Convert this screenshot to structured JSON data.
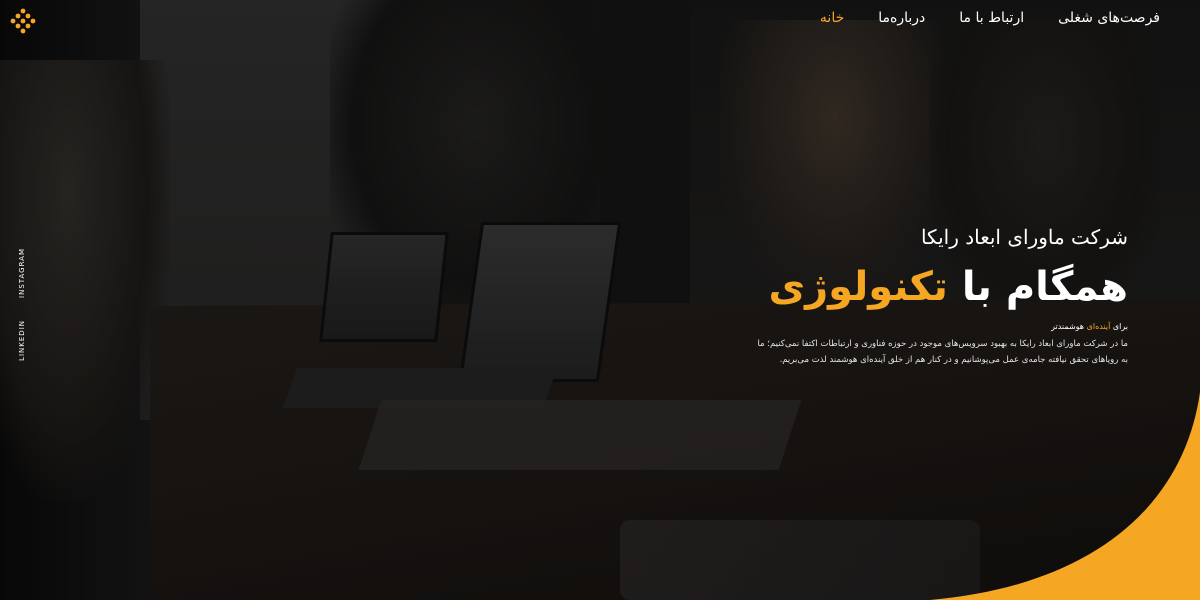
{
  "nav": {
    "items": [
      {
        "label": "خانه",
        "active": true
      },
      {
        "label": "درباره‌ما",
        "active": false
      },
      {
        "label": "ارتباط با ما",
        "active": false
      },
      {
        "label": "فرصت‌های شغلی",
        "active": false
      }
    ],
    "logo_icon": "diamond-dots-logo"
  },
  "social": {
    "instagram": "INSTAGRAM",
    "linkedin": "LINKEDIN"
  },
  "hero": {
    "subtitle": "شرکت ماورای ابعاد رایکا",
    "headline_white": "همگام با",
    "headline_orange": "تکنولوژی",
    "tagline_prefix": "برای",
    "tagline_highlight": "آینده‌ای",
    "tagline_suffix": "هوشمندتر",
    "description_line1": "ما در شرکت ماورای ابعاد رایکا به بهبود سرویس‌های موجود در حوزه فناوری و ارتباطات اکتفا نمی‌کنیم؛ ما",
    "description_line2": "به رویاهای تحقق نیافته جامه‌ی عمل می‌پوشانیم و در کنار هم از خلق آینده‌ای هوشمند لذت می‌بریم."
  },
  "colors": {
    "accent": "#f5a623",
    "text": "#ffffff",
    "background": "#1b1b1b"
  }
}
